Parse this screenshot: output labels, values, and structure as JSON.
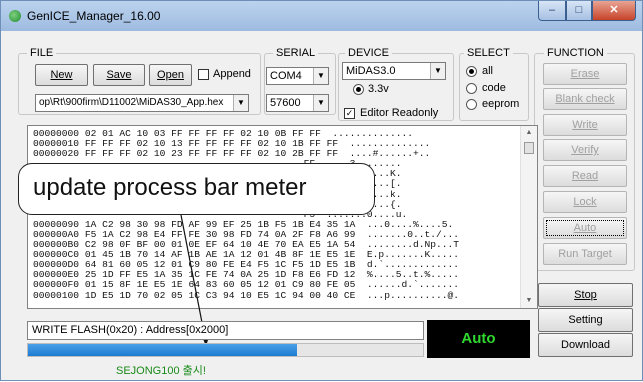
{
  "window": {
    "title": "GenICE_Manager_16.00",
    "min": "–",
    "max": "□",
    "close": "✕"
  },
  "file": {
    "label": "FILE",
    "new": "New",
    "save": "Save",
    "open": "Open",
    "append_label": "Append",
    "append_checked": false,
    "path": "op\\Rt\\900firm\\D11002\\MiDAS30_App.hex"
  },
  "serial": {
    "label": "SERIAL",
    "port": "COM4",
    "baud": "57600"
  },
  "device": {
    "label": "DEVICE",
    "model": "MiDAS3.0",
    "voltage": "3.3v",
    "voltage_selected": true,
    "editor_readonly_label": "Editor Readonly",
    "editor_readonly_checked": true
  },
  "select": {
    "label": "SELECT",
    "options": [
      "all",
      "code",
      "eeprom"
    ],
    "selected": "all"
  },
  "function": {
    "label": "FUNCTION",
    "buttons": [
      "Erase",
      "Blank check",
      "Write",
      "Verify",
      "Read",
      "Lock",
      "Auto",
      "Run Target"
    ],
    "stop": "Stop",
    "setting": "Setting",
    "download": "Download"
  },
  "hex_lines": [
    "00000000 02 01 AC 10 03 FF FF FF FF 02 10 0B FF FF  ..............",
    "00000010 FF FF FF 02 10 13 FF FF FF FF 02 10 1B FF FF  ..............",
    "00000020 FF FF FF 02 10 23 FF FF FF FF 02 10 2B FF FF  ....#......+..",
    "                                               FF  ....3........",
    "                                               FF  ....C......K.",
    "                                               FF  ....S......[.",
    "                                               FF  ....c......k.",
    "                                               FF  ....s......{.",
    "                                               F5  .......0....u.",
    "00000090 1A C2 98 30 98 FD AF 99 EF 25 1B F5 1B E4 35 1A  ...0....%....5.",
    "000000A0 F5 1A C2 98 E4 FF FE 30 98 FD 74 0A 2F F8 A6 99  .......0..t./...",
    "000000B0 C2 98 0F BF 00 01 0E EF 64 10 4E 70 EA E5 1A 54  ........d.Np...T",
    "000000C0 01 45 1B 70 14 AF 1B AE 1A 12 01 4B 8F 1E E5 1E  E.p.......K.....",
    "000000D0 64 81 60 05 12 01 C9 80 FE E4 F5 1C F5 1D E5 1B  d.`.............",
    "000000E0 25 1D FF E5 1A 35 1C FE 74 0A 25 1D F8 E6 FD 12  %....5..t.%.....",
    "000000F0 01 15 8F 1E E5 1E 64 83 60 05 12 01 C9 80 FE 05  ......d.`.......",
    "00000100 1D E5 1D 70 02 05 1C C3 94 10 E5 1C 94 00 40 CE  ...p..........@."
  ],
  "callout": "update process bar meter",
  "status_text": "WRITE FLASH(0x20) : Address[0x2000]",
  "progress_fraction": 0.68,
  "auto_label": "Auto",
  "footer": "SEJONG100 출시!"
}
